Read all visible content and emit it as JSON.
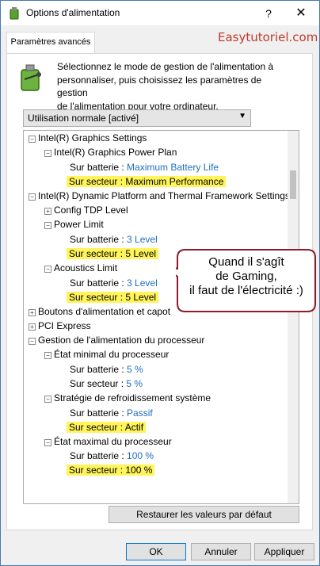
{
  "window": {
    "title": "Options d'alimentation",
    "help": "?",
    "close": "✕"
  },
  "tab": {
    "label": "Paramètres avancés"
  },
  "watermark": "Easytutoriel.com",
  "description": [
    "Sélectionnez le mode de gestion de l'alimentation à",
    "personnaliser, puis choisissez les paramètres de gestion",
    "de l'alimentation pour votre ordinateur."
  ],
  "plan_select": {
    "value": "Utilisation normale [activé]"
  },
  "tree": {
    "intel_graphics": "Intel(R) Graphics Settings",
    "igpp": "Intel(R) Graphics Power Plan",
    "igpp_battery_label": "Sur batterie :",
    "igpp_battery_value": "Maximum Battery Life",
    "igpp_ac_label": "Sur secteur :",
    "igpp_ac_value": "Maximum Performance",
    "dptf": "Intel(R) Dynamic Platform and Thermal Framework Settings",
    "config_tdp": "Config TDP Level",
    "power_limit": "Power Limit",
    "pl_battery_label": "Sur batterie :",
    "pl_battery_value": "3 Level",
    "pl_ac_label": "Sur secteur :",
    "pl_ac_value": "5 Level",
    "acoustics": "Acoustics Limit",
    "ac_battery_label": "Sur batterie :",
    "ac_battery_value": "3 Level",
    "ac_ac_label": "Sur secteur :",
    "ac_ac_value": "5 Level",
    "buttons": "Boutons d'alimentation et capot",
    "pci": "PCI Express",
    "cpu_mgmt": "Gestion de l'alimentation du processeur",
    "min_state": "État minimal du processeur",
    "min_battery_label": "Sur batterie :",
    "min_battery_value": "5  %",
    "min_ac_label": "Sur secteur :",
    "min_ac_value": "5  %",
    "cooling": "Stratégie de refroidissement système",
    "cool_battery_label": "Sur batterie :",
    "cool_battery_value": "Passif",
    "cool_ac_label": "Sur secteur :",
    "cool_ac_value": "Actif",
    "max_state": "État maximal du processeur",
    "max_battery_label": "Sur batterie :",
    "max_battery_value": "100  %",
    "max_ac_label": "Sur secteur :",
    "max_ac_value": "100  %"
  },
  "annotation": [
    "Quand il s'agît",
    "de Gaming,",
    "il faut de l'électricité :)"
  ],
  "buttons": {
    "restore": "Restaurer les valeurs par défaut",
    "ok": "OK",
    "cancel": "Annuler",
    "apply": "Appliquer"
  },
  "colors": {
    "highlight": "#fff45a",
    "value_blue": "#1f6fbf",
    "bubble_border": "#8b1a2b",
    "watermark": "#c0392b"
  }
}
